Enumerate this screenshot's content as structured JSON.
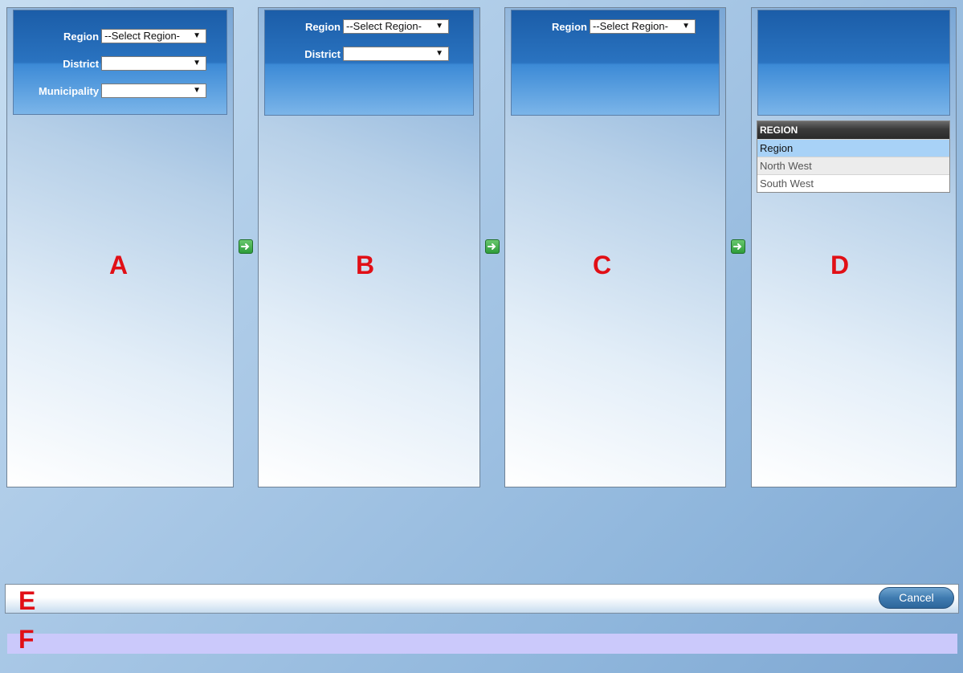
{
  "panel_a": {
    "letter": "A",
    "region_label": "Region",
    "region_value": "--Select Region-",
    "district_label": "District",
    "district_value": "",
    "municipality_label": "Municipality",
    "municipality_value": ""
  },
  "panel_b": {
    "letter": "B",
    "region_label": "Region",
    "region_value": "--Select Region-",
    "district_label": "District",
    "district_value": ""
  },
  "panel_c": {
    "letter": "C",
    "region_label": "Region",
    "region_value": "--Select Region-"
  },
  "panel_d": {
    "letter": "D",
    "table_header": "REGION",
    "rows": [
      "Region",
      "North West",
      "South West"
    ]
  },
  "arrow_icon": "next-arrow-icon",
  "bottom_bar": {
    "letter": "E",
    "cancel_label": "Cancel"
  },
  "status_strip": {
    "letter": "F"
  },
  "colors": {
    "accent_red": "#e10f16",
    "header_blue": "#2a73c0",
    "selected_row": "#a8d2f7",
    "status_strip": "#cbc9fb"
  }
}
